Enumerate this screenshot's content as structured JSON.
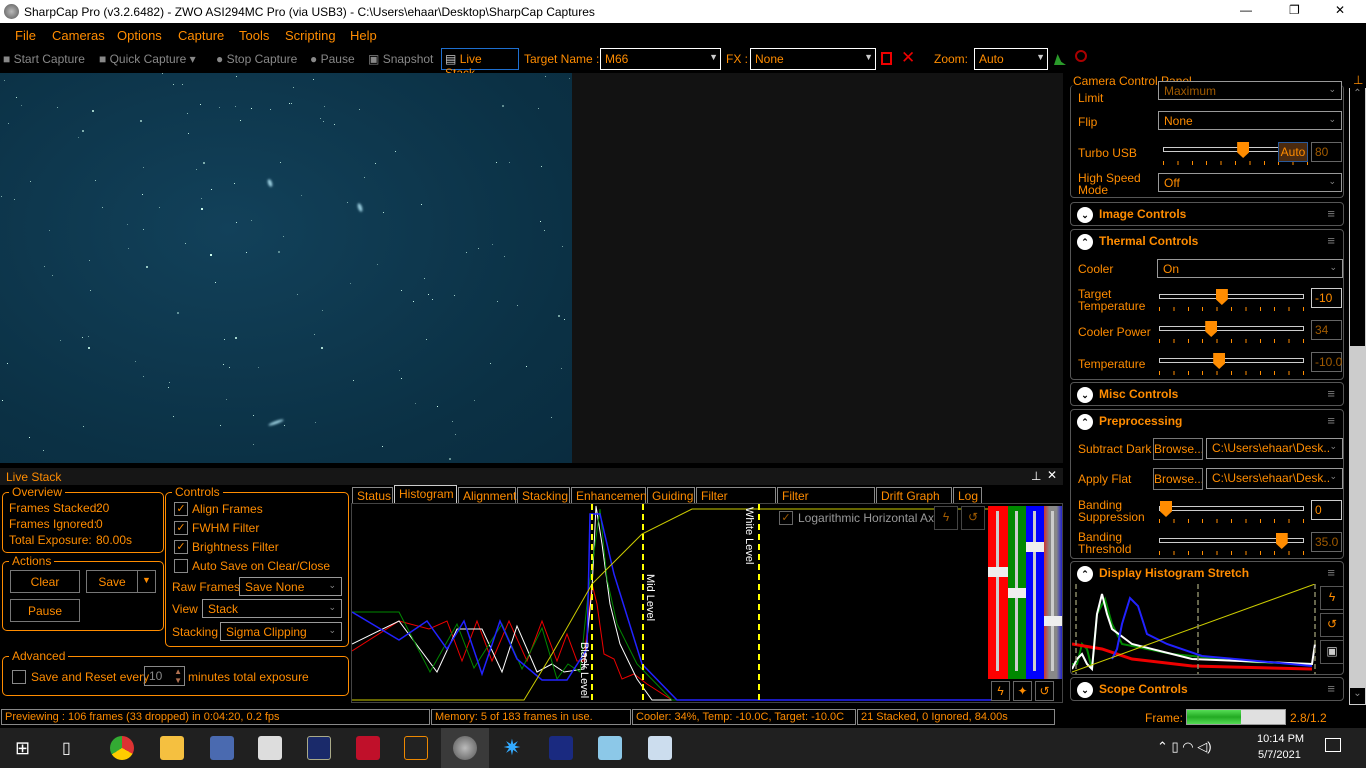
{
  "window": {
    "title": "SharpCap Pro (v3.2.6482) - ZWO ASI294MC Pro (via USB3) - C:\\Users\\ehaar\\Desktop\\SharpCap Captures",
    "controls": [
      "—",
      "❐",
      "✕"
    ]
  },
  "menu": [
    "File",
    "Cameras",
    "Options",
    "Capture",
    "Tools",
    "Scripting",
    "Help"
  ],
  "toolbar": {
    "start_capture": "Start Capture",
    "quick_capture": "Quick Capture",
    "stop_capture": "Stop Capture",
    "pause": "Pause",
    "snapshot": "Snapshot",
    "live_stack": "Live Stack",
    "target_label": "Target Name :",
    "target_value": "M66",
    "fx_label": "FX :",
    "fx_value": "None",
    "zoom_label": "Zoom:",
    "zoom_value": "Auto"
  },
  "livestack": {
    "title": "Live Stack",
    "overview": {
      "legend": "Overview",
      "frames_stacked_label": "Frames Stacked:",
      "frames_stacked": "20",
      "frames_ignored_label": "Frames Ignored:",
      "frames_ignored": "0",
      "total_exposure_label": "Total Exposure:",
      "total_exposure": "80.00s"
    },
    "actions": {
      "legend": "Actions",
      "clear": "Clear",
      "save": "Save",
      "pause": "Pause"
    },
    "controls": {
      "legend": "Controls",
      "align": "Align Frames",
      "align_checked": true,
      "fwhm": "FWHM Filter",
      "fwhm_checked": true,
      "brightness": "Brightness Filter",
      "brightness_checked": true,
      "autosave": "Auto Save on Clear/Close",
      "autosave_checked": false,
      "raw_label": "Raw Frames",
      "raw_value": "Save None",
      "view_label": "View",
      "view_value": "Stack",
      "stacking_label": "Stacking",
      "stacking_value": "Sigma Clipping"
    },
    "advanced": {
      "legend": "Advanced",
      "save_reset": "Save and Reset every",
      "minutes": "10",
      "suffix": "minutes total exposure"
    },
    "tabs": [
      "Status",
      "Histogram",
      "Alignment",
      "Stacking",
      "Enhancement",
      "Guiding",
      "Filter (FWHM)",
      "Filter (Brightness)",
      "Drift Graph",
      "Log"
    ],
    "active_tab": "Histogram",
    "histogram": {
      "log_axis": "Logarithmic Horizontal Axis",
      "log_checked": true,
      "black": "Black Level",
      "mid": "Mid Level",
      "white": "White Level"
    }
  },
  "panel": {
    "title": "Camera Control Panel",
    "limit_label": "Limit",
    "limit_value": "Maximum",
    "flip_label": "Flip",
    "flip_value": "None",
    "turbo_label": "Turbo USB",
    "turbo_auto": "Auto",
    "turbo_value": "80",
    "turbo_pct": 0.55,
    "hs_label1": "High Speed",
    "hs_label2": "Mode",
    "hs_value": "Off",
    "image_controls": "Image Controls",
    "thermal_controls": "Thermal Controls",
    "cooler_label": "Cooler",
    "cooler_value": "On",
    "tt_label1": "Target",
    "tt_label2": "Temperature",
    "tt_value": "-10",
    "tt_pct": 0.42,
    "cp_label": "Cooler Power",
    "cp_value": "34",
    "cp_pct": 0.34,
    "temp_label": "Temperature",
    "temp_value": "-10.0",
    "temp_pct": 0.4,
    "misc_controls": "Misc Controls",
    "preprocessing": "Preprocessing",
    "dark_label": "Subtract Dark",
    "browse": "Browse...",
    "dark_value": "C:\\Users\\ehaar\\Desk...",
    "flat_label": "Apply Flat",
    "flat_value": "C:\\Users\\ehaar\\Desk...",
    "bs_label1": "Banding",
    "bs_label2": "Suppression",
    "bs_value": "0",
    "bs_pct": 0,
    "bt_label1": "Banding",
    "bt_label2": "Threshold",
    "bt_value": "35.0",
    "bt_pct": 0.87,
    "dhs": "Display Histogram Stretch",
    "scope_controls": "Scope Controls"
  },
  "status": {
    "preview": "Previewing : 106 frames (33 dropped) in 0:04:20, 0.2 fps",
    "memory": "Memory: 5 of 183 frames in use.",
    "cooler": "Cooler: 34%, Temp: -10.0C, Target: -10.0C",
    "stacked": "21 Stacked, 0 Ignored, 84.00s",
    "frame_label": "Frame:",
    "frame_value": "2.8/1.2",
    "frame_pct": 0.55
  },
  "taskbar": {
    "time": "10:14 PM",
    "date": "5/7/2021"
  },
  "colors": {
    "accent": "#ff8c00",
    "image_bg": "#0b3145"
  }
}
